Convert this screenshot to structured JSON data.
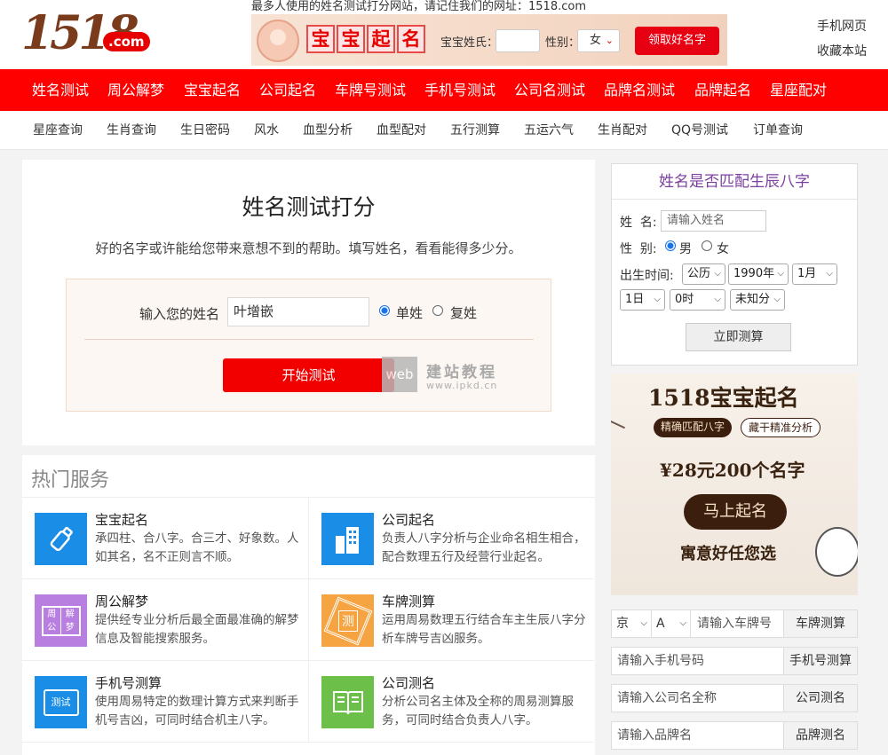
{
  "header": {
    "logo_num": "1518",
    "logo_com": ".com",
    "slogan": "最多人使用的姓名测试打分网站，请记住我们的网址：1518.com",
    "banner": {
      "title_chars": [
        "宝",
        "宝",
        "起",
        "名"
      ],
      "surname_label": "宝宝姓氏：",
      "gender_label": "性别：",
      "gender_value": "女",
      "button": "领取好名字"
    },
    "links": [
      "手机网页",
      "收藏本站"
    ]
  },
  "rednav": [
    "姓名测试",
    "周公解梦",
    "宝宝起名",
    "公司起名",
    "车牌号测试",
    "手机号测试",
    "公司名测试",
    "品牌名测试",
    "品牌起名",
    "星座配对"
  ],
  "subnav": [
    "星座查询",
    "生肖查询",
    "生日密码",
    "风水",
    "血型分析",
    "血型配对",
    "五行测算",
    "五运六气",
    "生肖配对",
    "QQ号测试",
    "订单查询"
  ],
  "main": {
    "title": "姓名测试打分",
    "subtitle": "好的名字或许能给您带来意想不到的帮助。填写姓名，看看能得多少分。",
    "name_label": "输入您的姓名",
    "name_value": "叶增嵌",
    "single_label": "单姓",
    "compound_label": "复姓",
    "start_button": "开始测试",
    "watermark_badge": "web",
    "watermark_text": "建站教程",
    "watermark_url": "www.ipkd.cn"
  },
  "hot": {
    "title": "热门服务",
    "services": [
      {
        "title": "宝宝起名",
        "desc": "承四柱、合八字。合三才、好象数。人如其名，名不正则言不顺。",
        "color": "#1a8ee6",
        "icon": "bottle-icon"
      },
      {
        "title": "公司起名",
        "desc": "负责人八字分析与企业命名相生相合，配合数理五行及经营行业起名。",
        "color": "#1a8ee6",
        "icon": "building-icon"
      },
      {
        "title": "周公解梦",
        "desc": "提供经专业分析后最全面最准确的解梦信息及智能搜索服务。",
        "color": "#b87fe0",
        "icon": "book-icon",
        "badges": [
          "周公",
          "解梦"
        ]
      },
      {
        "title": "车牌测算",
        "desc": "运用周易数理五行结合车主生辰八字分析车牌号吉凶服务。",
        "color": "#f6a341",
        "icon": "bagua-icon",
        "badges": [
          "测"
        ]
      },
      {
        "title": "手机号测算",
        "desc": "使用周易特定的数理计算方式来判断手机号吉凶，可同时结合机主八字。",
        "color": "#1a8ee6",
        "icon": "phone-icon",
        "badges": [
          "测试"
        ]
      },
      {
        "title": "公司测名",
        "desc": "分析公司名主体及全称的周易测算服务，可同时结合负责人八字。",
        "color": "#6cc04a",
        "icon": "open-book-icon"
      }
    ]
  },
  "bazi": {
    "title": "姓名是否匹配生辰八字",
    "name_label": "姓  名:",
    "name_placeholder": "请输入姓名",
    "gender_label": "性  别:",
    "male": "男",
    "female": "女",
    "time_label": "出生时间:",
    "calendar": "公历",
    "year": "1990年",
    "month": "1月",
    "day": "1日",
    "hour": "0时",
    "minute": "未知分",
    "button": "立即测算"
  },
  "ad": {
    "headline": "1518宝宝起名",
    "tag1": "精确匹配八字",
    "tag2": "藏干精准分析",
    "price": "¥28元200个名字",
    "cta": "马上起名",
    "footer": "寓意好任您选"
  },
  "quick": [
    {
      "placeholder": "请输入车牌号",
      "button": "车牌测算",
      "seg1": "京",
      "seg2": "A"
    },
    {
      "placeholder": "请输入手机号码",
      "button": "手机号测算"
    },
    {
      "placeholder": "请输入公司名全称",
      "button": "公司测名"
    },
    {
      "placeholder": "请输入品牌名",
      "button": "品牌测名"
    }
  ]
}
